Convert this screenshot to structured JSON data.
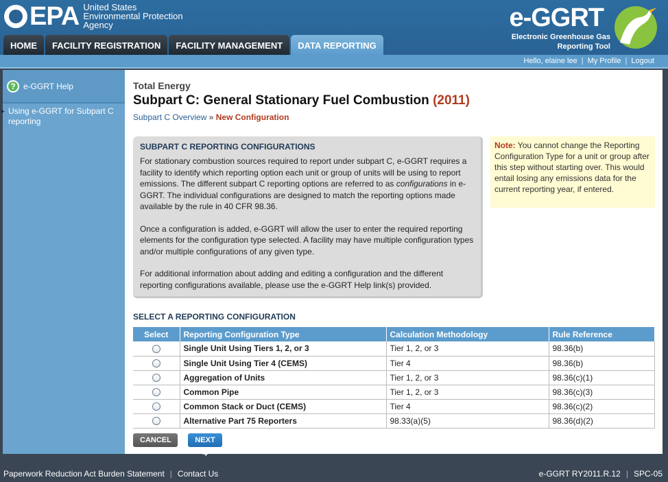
{
  "header": {
    "agency_letters": "EPA",
    "agency_line1": "United States",
    "agency_line2": "Environmental Protection",
    "agency_line3": "Agency",
    "app_title": "e-GGRT",
    "app_sub1": "Electronic Greenhouse Gas",
    "app_sub2": "Reporting Tool"
  },
  "nav": {
    "tabs": [
      {
        "label": "HOME"
      },
      {
        "label": "FACILITY REGISTRATION"
      },
      {
        "label": "FACILITY MANAGEMENT"
      },
      {
        "label": "DATA REPORTING"
      }
    ],
    "active": "DATA REPORTING"
  },
  "userbar": {
    "greeting": "Hello, elaine lee",
    "profile": "My Profile",
    "logout": "Logout"
  },
  "sidebar": {
    "help": "e-GGRT Help",
    "link": "Using e-GGRT for Subpart C reporting"
  },
  "main": {
    "org_name": "Total Energy",
    "title": "Subpart C: General Stationary Fuel Combustion",
    "year": "(2011)",
    "breadcrumb_link": "Subpart C Overview",
    "breadcrumb_sep": "»",
    "breadcrumb_current": "New Configuration"
  },
  "info": {
    "heading": "SUBPART C REPORTING CONFIGURATIONS",
    "p1_a": "For stationary combustion sources required to report under subpart C, e-GGRT requires a facility to identify which reporting option each unit or group of units will be using to report emissions. The different subpart C reporting options are referred to as ",
    "p1_em": "configurations",
    "p1_b": " in e-GGRT. The individual configurations are designed to match the reporting options made available by the rule in 40 CFR 98.36.",
    "p2": "Once a configuration is added, e-GGRT will allow the user to enter the required reporting elements for the configuration type selected. A facility may have multiple configuration types and/or multiple configurations of any given type.",
    "p3": "For additional information about adding and editing a configuration and the different reporting configurations available, please use the e-GGRT Help link(s) provided."
  },
  "note": {
    "label": "Note:",
    "text": " You cannot change the Reporting Configuration Type for a unit or group after this step without starting over. This would entail losing any emissions data for the current reporting year, if entered."
  },
  "table": {
    "heading": "SELECT A REPORTING CONFIGURATION",
    "columns": [
      "Select",
      "Reporting Configuration Type",
      "Calculation Methodology",
      "Rule Reference"
    ],
    "rows": [
      {
        "type": "Single Unit Using Tiers 1, 2, or 3",
        "method": "Tier 1, 2, or 3",
        "rule": "98.36(b)"
      },
      {
        "type": "Single Unit Using Tier 4 (CEMS)",
        "method": "Tier 4",
        "rule": "98.36(b)"
      },
      {
        "type": "Aggregation of Units",
        "method": "Tier 1, 2, or 3",
        "rule": "98.36(c)(1)"
      },
      {
        "type": "Common Pipe",
        "method": "Tier 1, 2, or 3",
        "rule": "98.36(c)(3)"
      },
      {
        "type": "Common Stack or Duct (CEMS)",
        "method": "Tier 4",
        "rule": "98.36(c)(2)"
      },
      {
        "type": "Alternative Part 75 Reporters",
        "method": "98.33(a)(5)",
        "rule": "98.36(d)(2)"
      }
    ]
  },
  "buttons": {
    "cancel": "CANCEL",
    "next": "NEXT"
  },
  "footer": {
    "paperwork": "Paperwork Reduction Act Burden Statement",
    "contact": "Contact Us",
    "version": "e-GGRT RY2011.R.12",
    "page_id": "SPC-05"
  }
}
